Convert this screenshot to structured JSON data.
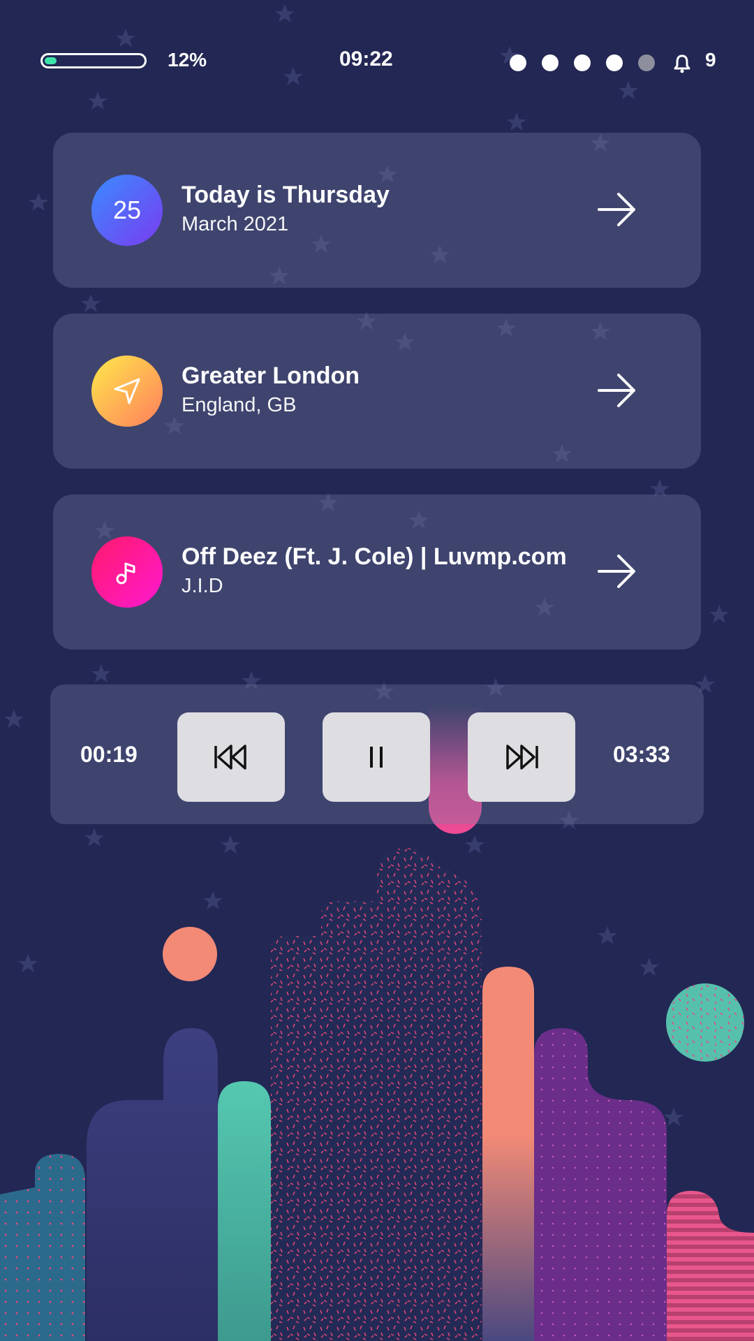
{
  "status_bar": {
    "battery_level": 0.12,
    "battery_percent": "12%",
    "time": "09:22",
    "signal_dots": [
      true,
      true,
      true,
      true,
      false
    ],
    "bell_icon": "bell-icon",
    "notification_count": "9"
  },
  "cards": [
    {
      "title": "Today is Thursday",
      "subtitle": "March 2021",
      "badge": "25",
      "icon": "calendar-day",
      "arrow_icon": "arrow-right-icon"
    },
    {
      "title": "Greater London",
      "subtitle": "England, GB",
      "icon": "navigation-icon",
      "arrow_icon": "arrow-right-icon"
    },
    {
      "title": "Off Deez (Ft. J. Cole) | Luvmp.com",
      "subtitle": "J.I.D",
      "icon": "music-note-icon",
      "arrow_icon": "arrow-right-icon"
    }
  ],
  "player": {
    "elapsed": "00:19",
    "duration": "03:33",
    "buttons": [
      "previous-icon",
      "pause-icon",
      "next-icon"
    ]
  },
  "colors": {
    "background": "#222754",
    "card": "rgba(120,128,165,0.33)",
    "accent_green": "#3ee3a8",
    "accent_pink": "#f04c95",
    "calendar_gradient": [
      "#3a8bff",
      "#7a3cf0"
    ],
    "location_gradient": [
      "#ffe94a",
      "#ff7e5c"
    ],
    "music_gradient": [
      "#ff1a6b",
      "#ff1ad0"
    ]
  }
}
